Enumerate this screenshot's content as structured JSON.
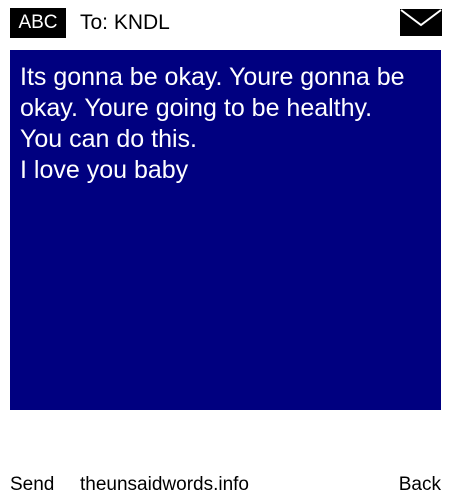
{
  "header": {
    "mode": "ABC",
    "to_label": "To: KNDL",
    "icon": "envelope-icon"
  },
  "message": {
    "lines": [
      "Its gonna be okay. Youre gonna be",
      "okay. Youre going to be healthy.",
      "You can do this.",
      "I love you baby"
    ],
    "background": "#000080",
    "text_color": "#ffffff"
  },
  "softkeys": {
    "left": "Send",
    "center": "theunsaidwords.info",
    "right": "Back"
  }
}
